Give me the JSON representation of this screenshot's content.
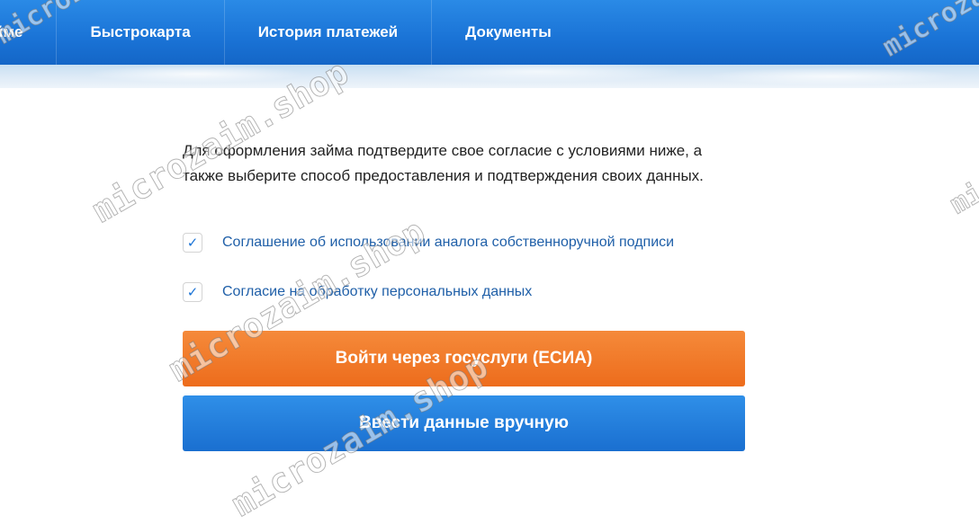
{
  "nav": {
    "items": [
      {
        "label": "йме"
      },
      {
        "label": "Быстрокарта"
      },
      {
        "label": "История платежей"
      },
      {
        "label": "Документы"
      }
    ]
  },
  "main": {
    "intro": "Для оформления займа подтвердите свое согласие с условиями ниже, а также выберите способ предоставления и подтверждения своих данных.",
    "consents": [
      {
        "label": "Соглашение об использовании аналога собственноручной подписи",
        "checked": true
      },
      {
        "label": "Согласие на обработку персональных данных",
        "checked": true
      }
    ],
    "check_mark": "✓",
    "buttons": {
      "gosuslugi": "Войти через госуслуги (ЕСИА)",
      "manual": "Ввести данные вручную"
    }
  },
  "watermark": {
    "text": "microzaim.shop"
  },
  "colors": {
    "nav_blue": "#1a73d6",
    "orange_button": "#ef6f1f",
    "blue_button": "#1f79d8",
    "link_blue": "#1f5fa8"
  }
}
